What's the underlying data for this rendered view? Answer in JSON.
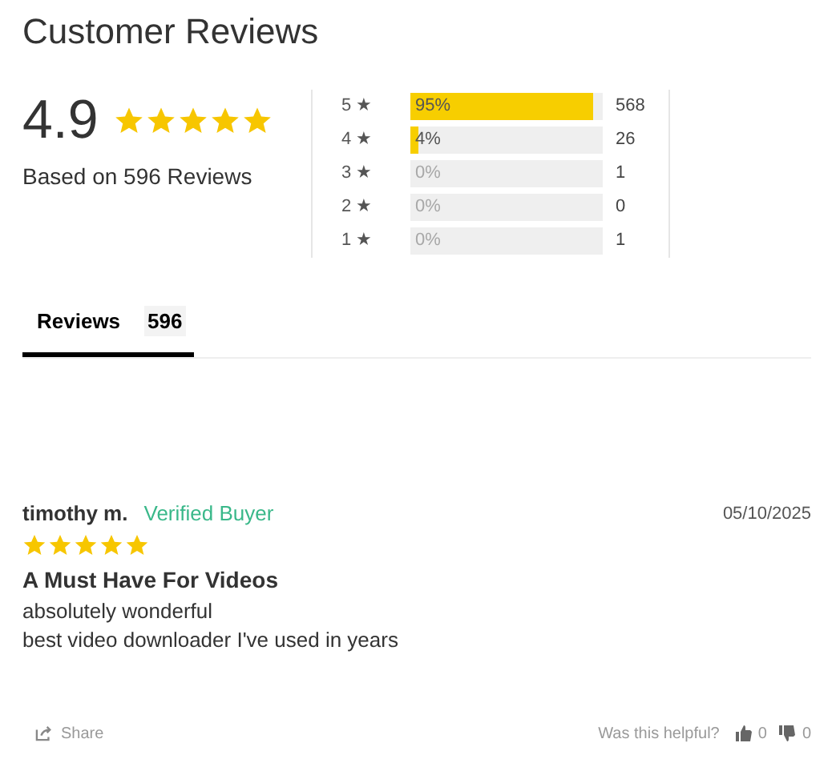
{
  "title": "Customer Reviews",
  "summary": {
    "average": "4.9",
    "stars": 5,
    "based_on": "Based on 596 Reviews"
  },
  "histogram": [
    {
      "label": "5 ★",
      "percent": "95%",
      "level": 0.95,
      "count": "568"
    },
    {
      "label": "4 ★",
      "percent": "4%",
      "level": 0.04,
      "count": "26"
    },
    {
      "label": "3 ★",
      "percent": "0%",
      "count": "1"
    },
    {
      "label": "2 ★",
      "percent": "0%",
      "count": "0"
    },
    {
      "label": "1 ★",
      "percent": "0%",
      "count": "1"
    }
  ],
  "tabs": [
    {
      "label": "Reviews",
      "count": "596",
      "selected": true
    }
  ],
  "reviews": [
    {
      "author": "timothy m.",
      "badge": "Verified Buyer",
      "date": "05/10/2025",
      "stars": 5,
      "title": "A Must Have For Videos",
      "body": [
        "absolutely wonderful",
        "best video downloader I've used in years"
      ],
      "share": "Share",
      "helpful_prompt": "Was this helpful?",
      "up_votes": "0",
      "down_votes": "0"
    }
  ]
}
